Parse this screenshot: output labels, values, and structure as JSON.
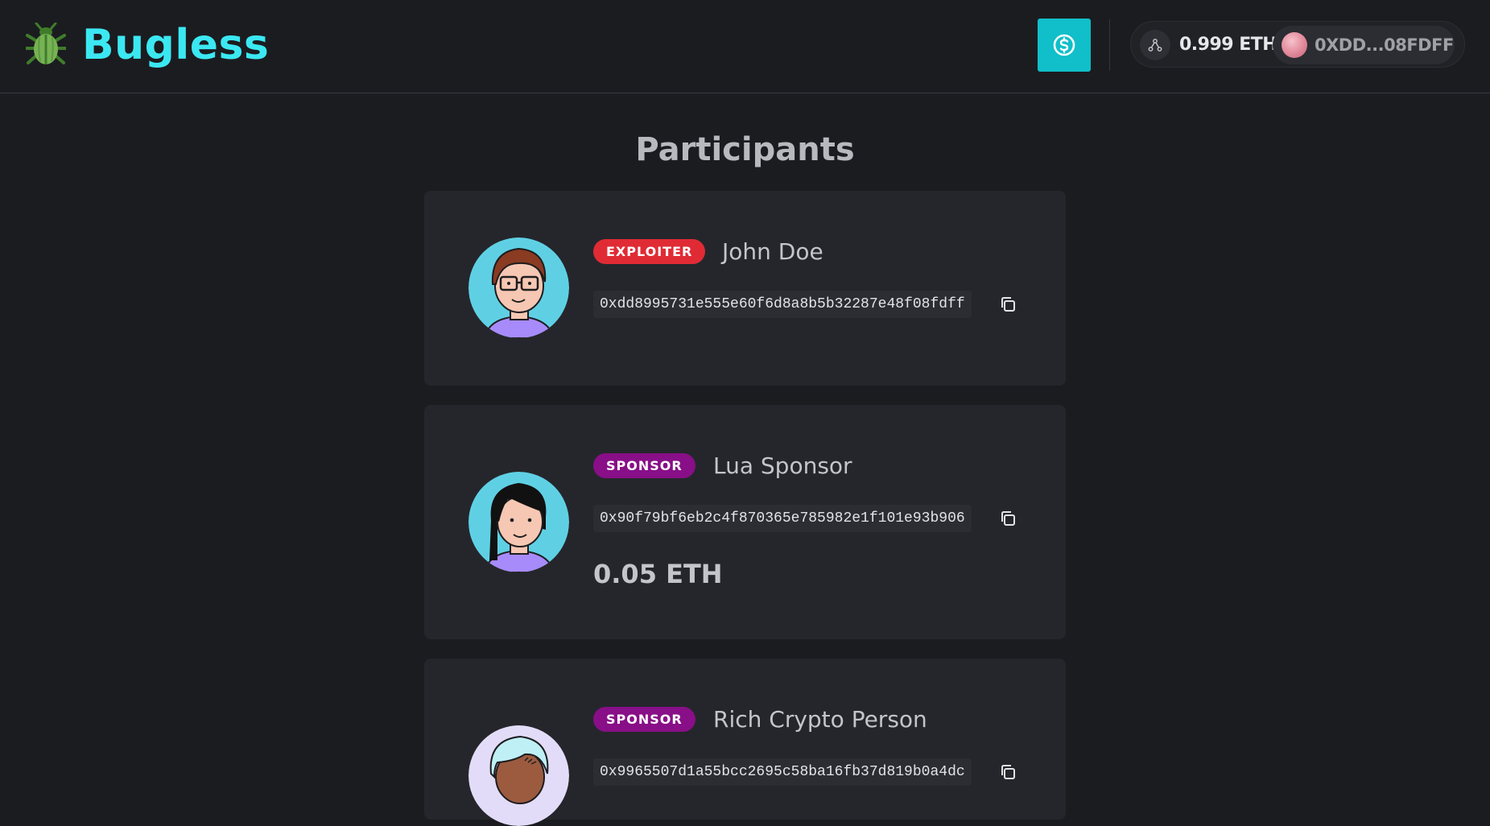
{
  "header": {
    "brand": "Bugless",
    "wallet": {
      "balance": "0.999 ETH",
      "address": "0XDD...08FDFF"
    }
  },
  "main": {
    "title": "Participants",
    "participants": [
      {
        "role": "EXPLOITER",
        "name": "John Doe",
        "address": "0xdd8995731e555e60f6d8a8b5b32287e48f08fdff",
        "amount": ""
      },
      {
        "role": "SPONSOR",
        "name": "Lua Sponsor",
        "address": "0x90f79bf6eb2c4f870365e785982e1f101e93b906",
        "amount": "0.05 ETH"
      },
      {
        "role": "SPONSOR",
        "name": "Rich Crypto Person",
        "address": "0x9965507d1a55bcc2695c58ba16fb37d819b0a4dc",
        "amount": ""
      }
    ]
  },
  "colors": {
    "background": "#1b1c20",
    "card": "#25262b",
    "brand": "#3be8f2",
    "accent_button": "#10bfc9",
    "exploiter_badge": "#e02b35",
    "sponsor_badge": "#880f87"
  },
  "icons": {
    "logo": "beetle-logo-icon",
    "dollar_button": "dollar-coin-icon",
    "network": "network-nodes-icon",
    "copy": "copy-icon"
  }
}
